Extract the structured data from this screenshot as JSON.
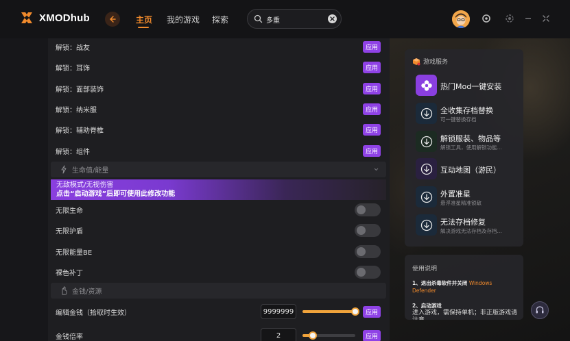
{
  "app": {
    "name": "XMODhub"
  },
  "nav": {
    "items": [
      {
        "label": "主页",
        "active": true
      },
      {
        "label": "我的游戏",
        "active": false
      },
      {
        "label": "探索",
        "active": false
      }
    ]
  },
  "search": {
    "value": "多重"
  },
  "unlock_rows": [
    {
      "label": "解锁：战友",
      "button": "应用"
    },
    {
      "label": "解锁：耳饰",
      "button": "应用"
    },
    {
      "label": "解锁：面部装饰",
      "button": "应用"
    },
    {
      "label": "解锁：纳米服",
      "button": "应用"
    },
    {
      "label": "解锁：辅助脊椎",
      "button": "应用"
    },
    {
      "label": "解锁：组件",
      "button": "应用"
    }
  ],
  "sections": {
    "health": {
      "title": "生命值/能量"
    },
    "money": {
      "title": "金钱/资源"
    }
  },
  "banner": {
    "line1": "无敌模式/无视伤害",
    "line2": "点击“启动游戏”后即可使用此修改功能"
  },
  "toggle_rows": [
    {
      "label": "无限生命",
      "on": false
    },
    {
      "label": "无限护盾",
      "on": false
    },
    {
      "label": "无限能量BE",
      "on": false
    },
    {
      "label": "裸色补丁",
      "on": false
    }
  ],
  "money_rows": [
    {
      "label": "编辑金钱（拾取时生效）",
      "value": "9999999",
      "slider_fraction": 1.0,
      "button": "应用"
    },
    {
      "label": "金钱倍率",
      "value": "2",
      "slider_fraction": 0.2,
      "button": "应用"
    }
  ],
  "services": {
    "header": "游戏服务",
    "items": [
      {
        "title": "热门Mod一键安装",
        "subtitle": "",
        "icon": "flower-icon"
      },
      {
        "title": "全收集存档替换",
        "subtitle": "可一键替换存档",
        "icon": "download-circle-icon"
      },
      {
        "title": "解锁服装、物品等",
        "subtitle": "解锁工具，使用解锁功能...",
        "icon": "download-circle-icon"
      },
      {
        "title": "互动地图（游民）",
        "subtitle": "",
        "icon": "download-circle-icon"
      },
      {
        "title": "外置准星",
        "subtitle": "悬浮准星精准锁敌",
        "icon": "download-circle-icon"
      },
      {
        "title": "无法存档修复",
        "subtitle": "解决游戏无法存档及存档...",
        "icon": "download-circle-icon"
      }
    ]
  },
  "help": {
    "title": "使用说明",
    "step1_prefix": "1、退出杀毒软件并关闭 ",
    "step1_highlight": "Windows Defender",
    "step2_title": "2、启动游戏",
    "step2_body": "进入游戏，需保持单机；非正版游戏请注意..."
  },
  "colors": {
    "accent_orange": "#f08a2c",
    "apply_purple": "#8f42e6",
    "slider_orange": "#f0a33b"
  }
}
